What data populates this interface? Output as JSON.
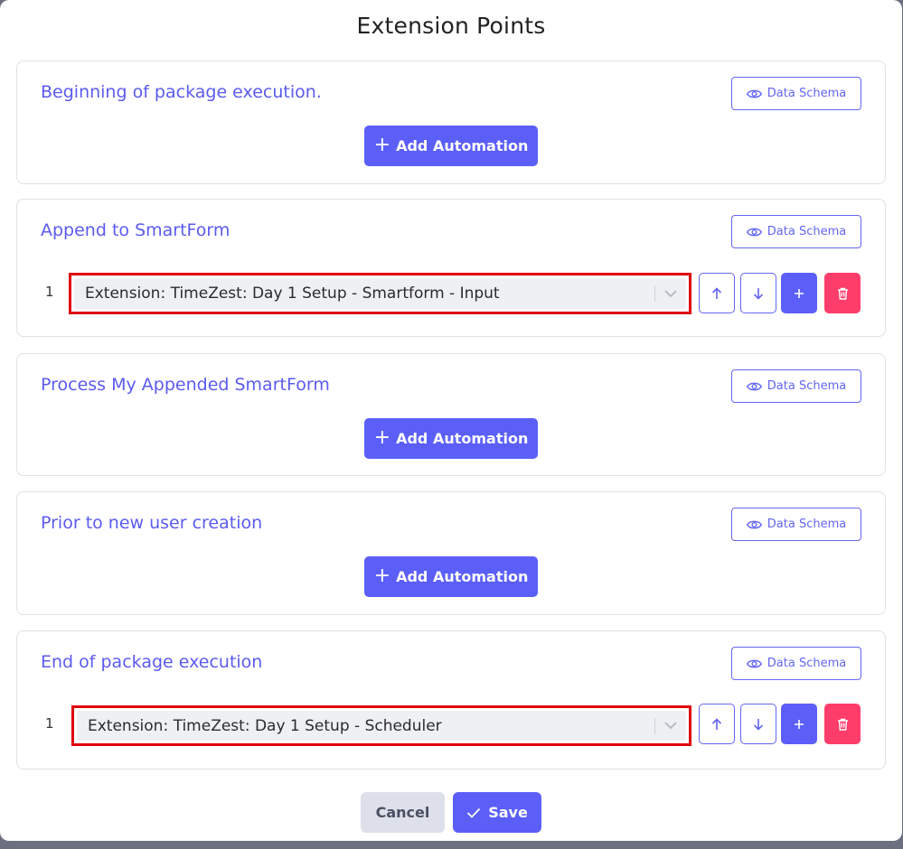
{
  "modal": {
    "title": "Extension Points"
  },
  "sections": [
    {
      "title": "Beginning of package execution.",
      "schema_label": "Data Schema",
      "add_label": "Add Automation"
    },
    {
      "title": "Append to SmartForm",
      "schema_label": "Data Schema",
      "rows": [
        {
          "index": "1",
          "value": "Extension: TimeZest: Day 1 Setup - Smartform - Input"
        }
      ]
    },
    {
      "title": "Process My Appended SmartForm",
      "schema_label": "Data Schema",
      "add_label": "Add Automation"
    },
    {
      "title": "Prior to new user creation",
      "schema_label": "Data Schema",
      "add_label": "Add Automation"
    },
    {
      "title": "End of package execution",
      "schema_label": "Data Schema",
      "rows": [
        {
          "index": "1",
          "value": "Extension: TimeZest: Day 1 Setup - Scheduler"
        }
      ]
    }
  ],
  "footer": {
    "cancel_label": "Cancel",
    "save_label": "Save"
  },
  "colors": {
    "accent": "#5b5ff8",
    "danger": "#ff3d6a",
    "highlight": "#e0000b"
  },
  "icons": [
    "eye-icon",
    "plus-icon",
    "arrow-up-icon",
    "arrow-down-icon",
    "trash-icon",
    "chevron-down-icon",
    "check-icon"
  ]
}
